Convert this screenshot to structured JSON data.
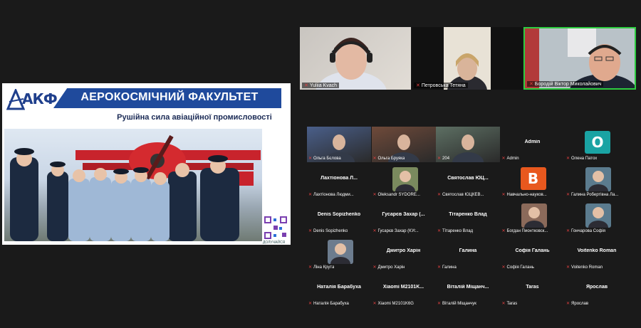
{
  "slide": {
    "logo_text": "АКФ",
    "title": "АЕРОКОСМІЧНИЙ ФАКУЛЬТЕТ",
    "subtitle": "Рушійна сила авіаційної промисловості",
    "qr_caption": "ДОЛУЧАЙСЯ"
  },
  "top_videos": [
    {
      "name": "Yuliia Kvach"
    },
    {
      "name": "Петровська Тетяна"
    },
    {
      "name": "Бородій Віктор Миколайович"
    }
  ],
  "grid": [
    {
      "display": "",
      "label": "Ольга Бєлова",
      "type": "video"
    },
    {
      "display": "",
      "label": "Ольга Бруяка",
      "type": "video"
    },
    {
      "display": "",
      "label": "204",
      "type": "video"
    },
    {
      "display": "Admin",
      "label": "Admin",
      "type": "name"
    },
    {
      "display": "",
      "label": "Олена Патох",
      "type": "letter",
      "letter": "O",
      "color": "#1aa3a3"
    },
    {
      "display": "Лахтіонова Л...",
      "label": "Лахтіонова Людми...",
      "type": "name"
    },
    {
      "display": "",
      "label": "Oleksandr SYDORE...",
      "type": "avatar"
    },
    {
      "display": "Святослав ЮЦ...",
      "label": "Святослав ЮЦКЕВ...",
      "type": "name"
    },
    {
      "display": "",
      "label": "Навчально-науков...",
      "type": "letter",
      "letter": "B",
      "color": "#e8581e"
    },
    {
      "display": "",
      "label": "Галина Робертівна Ла...",
      "type": "avatar"
    },
    {
      "display": "Denis Sopizhenko",
      "label": "Denis Sopizhenko",
      "type": "name"
    },
    {
      "display": "Гусарєв Захар (...",
      "label": "Гусарєв Захар (КУг...",
      "type": "name"
    },
    {
      "display": "Тітаренко Влад",
      "label": "Тітаренко Влад",
      "type": "name"
    },
    {
      "display": "",
      "label": "Богдан Пионтковск...",
      "type": "avatar"
    },
    {
      "display": "",
      "label": "Гончарова Софія",
      "type": "avatar"
    },
    {
      "display": "",
      "label": "Ліна Крута",
      "type": "avatar"
    },
    {
      "display": "Дмитро Харін",
      "label": "Дмитро Харін",
      "type": "name"
    },
    {
      "display": "Галина",
      "label": "Галина",
      "type": "name"
    },
    {
      "display": "Софія Галань",
      "label": "Софія Галань",
      "type": "name"
    },
    {
      "display": "Voitenko Roman",
      "label": "Voitenko Roman",
      "type": "name"
    },
    {
      "display": "Наталія Барабуха",
      "label": "Наталія Барабуха",
      "type": "name"
    },
    {
      "display": "Xiaomi M2101K...",
      "label": "Xiaomi M2101K6G",
      "type": "name"
    },
    {
      "display": "Віталій Міщанч...",
      "label": "Віталій Міщанчук",
      "type": "name"
    },
    {
      "display": "Taras",
      "label": "Taras",
      "type": "name"
    },
    {
      "display": "Ярослав",
      "label": "Ярослав",
      "type": "name"
    }
  ]
}
